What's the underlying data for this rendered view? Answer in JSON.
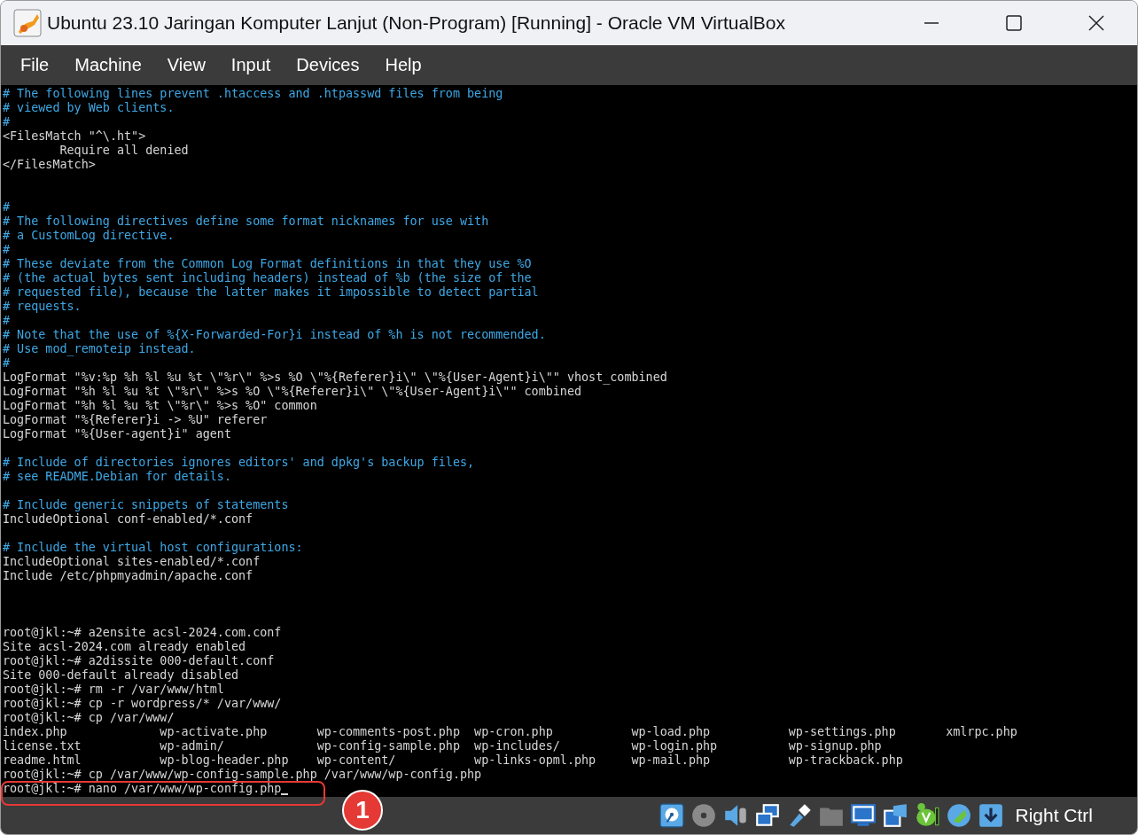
{
  "window": {
    "title": "Ubuntu 23.10 Jaringan Komputer Lanjut (Non-Program) [Running] - Oracle VM VirtualBox"
  },
  "menu": [
    {
      "label": "File"
    },
    {
      "label": "Machine"
    },
    {
      "label": "View"
    },
    {
      "label": "Input"
    },
    {
      "label": "Devices"
    },
    {
      "label": "Help"
    }
  ],
  "terminal": {
    "cursor_visible": true,
    "lines": [
      {
        "kind": "comment",
        "text": "# The following lines prevent .htaccess and .htpasswd files from being"
      },
      {
        "kind": "comment",
        "text": "# viewed by Web clients."
      },
      {
        "kind": "comment",
        "text": "#"
      },
      {
        "kind": "code",
        "text": "<FilesMatch \"^\\.ht\">"
      },
      {
        "kind": "code",
        "text": "        Require all denied"
      },
      {
        "kind": "code",
        "text": "</FilesMatch>"
      },
      {
        "kind": "blank"
      },
      {
        "kind": "blank"
      },
      {
        "kind": "comment",
        "text": "#"
      },
      {
        "kind": "comment",
        "text": "# The following directives define some format nicknames for use with"
      },
      {
        "kind": "comment",
        "text": "# a CustomLog directive."
      },
      {
        "kind": "comment",
        "text": "#"
      },
      {
        "kind": "comment",
        "text": "# These deviate from the Common Log Format definitions in that they use %O"
      },
      {
        "kind": "comment",
        "text": "# (the actual bytes sent including headers) instead of %b (the size of the"
      },
      {
        "kind": "comment",
        "text": "# requested file), because the latter makes it impossible to detect partial"
      },
      {
        "kind": "comment",
        "text": "# requests."
      },
      {
        "kind": "comment",
        "text": "#"
      },
      {
        "kind": "comment",
        "text": "# Note that the use of %{X-Forwarded-For}i instead of %h is not recommended."
      },
      {
        "kind": "comment",
        "text": "# Use mod_remoteip instead."
      },
      {
        "kind": "comment",
        "text": "#"
      },
      {
        "kind": "code",
        "text": "LogFormat \"%v:%p %h %l %u %t \\\"%r\\\" %>s %O \\\"%{Referer}i\\\" \\\"%{User-Agent}i\\\"\" vhost_combined"
      },
      {
        "kind": "code",
        "text": "LogFormat \"%h %l %u %t \\\"%r\\\" %>s %O \\\"%{Referer}i\\\" \\\"%{User-Agent}i\\\"\" combined"
      },
      {
        "kind": "code",
        "text": "LogFormat \"%h %l %u %t \\\"%r\\\" %>s %O\" common"
      },
      {
        "kind": "code",
        "text": "LogFormat \"%{Referer}i -> %U\" referer"
      },
      {
        "kind": "code",
        "text": "LogFormat \"%{User-agent}i\" agent"
      },
      {
        "kind": "blank"
      },
      {
        "kind": "comment",
        "text": "# Include of directories ignores editors' and dpkg's backup files,"
      },
      {
        "kind": "comment",
        "text": "# see README.Debian for details."
      },
      {
        "kind": "blank"
      },
      {
        "kind": "comment",
        "text": "# Include generic snippets of statements"
      },
      {
        "kind": "code",
        "text": "IncludeOptional conf-enabled/*.conf"
      },
      {
        "kind": "blank"
      },
      {
        "kind": "comment",
        "text": "# Include the virtual host configurations:"
      },
      {
        "kind": "code",
        "text": "IncludeOptional sites-enabled/*.conf"
      },
      {
        "kind": "code",
        "text": "Include /etc/phpmyadmin/apache.conf"
      },
      {
        "kind": "blank"
      },
      {
        "kind": "blank"
      },
      {
        "kind": "blank"
      },
      {
        "kind": "code",
        "text": "root@jkl:~# a2ensite acsl-2024.com.conf"
      },
      {
        "kind": "code",
        "text": "Site acsl-2024.com already enabled"
      },
      {
        "kind": "code",
        "text": "root@jkl:~# a2dissite 000-default.conf"
      },
      {
        "kind": "code",
        "text": "Site 000-default already disabled"
      },
      {
        "kind": "code",
        "text": "root@jkl:~# rm -r /var/www/html"
      },
      {
        "kind": "code",
        "text": "root@jkl:~# cp -r wordpress/* /var/www/"
      },
      {
        "kind": "code",
        "text": "root@jkl:~# cp /var/www/"
      },
      {
        "kind": "columns",
        "cells": [
          "index.php",
          "wp-activate.php",
          "wp-comments-post.php",
          "wp-cron.php",
          "wp-load.php",
          "wp-settings.php",
          "xmlrpc.php"
        ]
      },
      {
        "kind": "columns",
        "cells": [
          "license.txt",
          "wp-admin/",
          "wp-config-sample.php",
          "wp-includes/",
          "wp-login.php",
          "wp-signup.php"
        ]
      },
      {
        "kind": "columns",
        "cells": [
          "readme.html",
          "wp-blog-header.php",
          "wp-content/",
          "wp-links-opml.php",
          "wp-mail.php",
          "wp-trackback.php"
        ]
      },
      {
        "kind": "code",
        "text": "root@jkl:~# cp /var/www/wp-config-sample.php /var/www/wp-config.php"
      },
      {
        "kind": "code",
        "text": "root@jkl:~# nano /var/www/wp-config.php"
      }
    ]
  },
  "annotation": {
    "label": "1"
  },
  "status_bar": {
    "host_key": "Right Ctrl"
  }
}
